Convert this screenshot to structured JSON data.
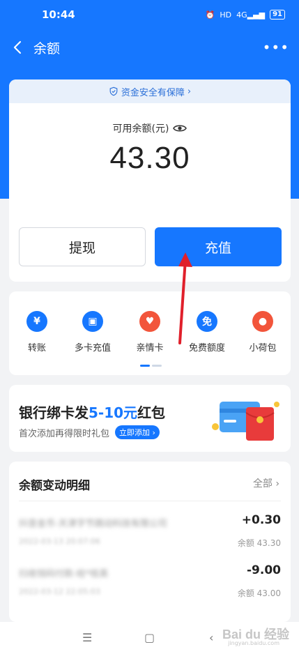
{
  "status": {
    "time": "10:44",
    "hd": "HD",
    "signal": "4G",
    "battery": "91"
  },
  "nav": {
    "title": "余额"
  },
  "balance": {
    "safety": "资金安全有保障",
    "label": "可用余额(元)",
    "value": "43.30",
    "withdraw": "提现",
    "recharge": "充值"
  },
  "quick": {
    "items": [
      {
        "label": "转账",
        "icon": "yuan-transfer-icon",
        "color": "#1677ff"
      },
      {
        "label": "多卡充值",
        "icon": "wallet-icon",
        "color": "#1677ff"
      },
      {
        "label": "亲情卡",
        "icon": "heart-icon",
        "color": "#f2553b"
      },
      {
        "label": "免费额度",
        "icon": "free-quota-icon",
        "color": "#1677ff"
      },
      {
        "label": "小荷包",
        "icon": "purse-icon",
        "color": "#f2553b"
      }
    ]
  },
  "promo": {
    "title_a": "银行绑卡发",
    "title_hl": "5-10元",
    "title_b": "红包",
    "subtitle": "首次添加再得限时礼包",
    "button": "立即添加"
  },
  "detail": {
    "title": "余额变动明细",
    "more": "全部",
    "rows": [
      {
        "name": "抖音金币-天津字节跳动科技有限公司",
        "time": "2022-03-13 20:07:06",
        "amount": "+0.30",
        "balance": "余额 43.30"
      },
      {
        "name": "扫收钱码付款-给*桂英",
        "time": "2022-03-12 22:05:03",
        "amount": "-9.00",
        "balance": "余额 43.00"
      }
    ]
  },
  "watermark": {
    "brand": "Bai du 经验",
    "url": "jingyan.baidu.com"
  }
}
